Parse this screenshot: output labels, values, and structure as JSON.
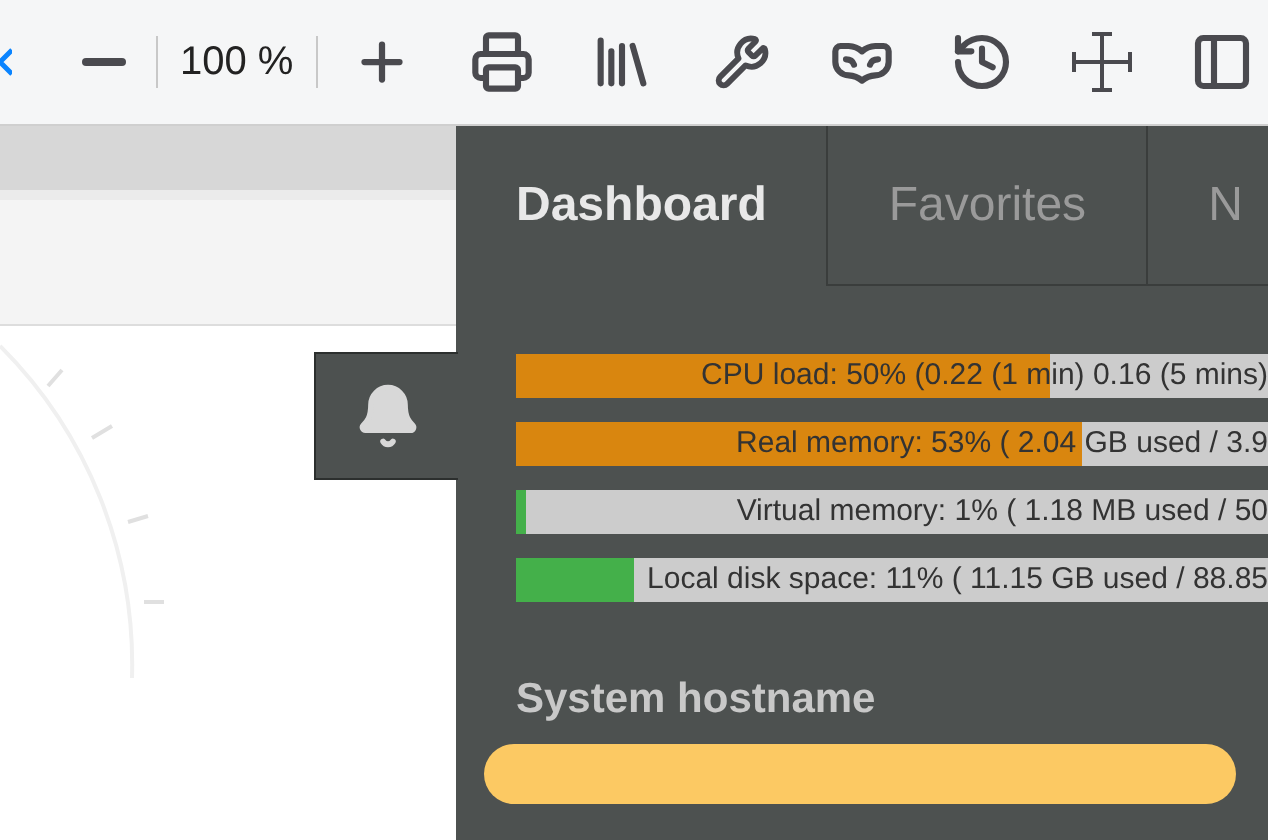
{
  "toolbar": {
    "zoom": "100 %"
  },
  "panel": {
    "tabs": [
      {
        "label": "Dashboard",
        "selected": true
      },
      {
        "label": "Favorites",
        "selected": false
      },
      {
        "label": "N",
        "selected": false
      }
    ],
    "meters": [
      {
        "label": "CPU load: 50% (0.22 (1 min) 0.16 (5 mins)",
        "level": 0.5,
        "color": "#d9860f"
      },
      {
        "label": "Real memory: 53% ( 2.04 GB used / 3.9",
        "level": 0.53,
        "color": "#d9860f"
      },
      {
        "label": "Virtual memory: 1% ( 1.18 MB used / 50",
        "level": 0.01,
        "color": "#44b04a"
      },
      {
        "label": "Local disk space: 11% ( 11.15 GB used / 88.85",
        "level": 0.11,
        "color": "#44b04a"
      }
    ],
    "hostname": {
      "heading": "System hostname"
    }
  }
}
